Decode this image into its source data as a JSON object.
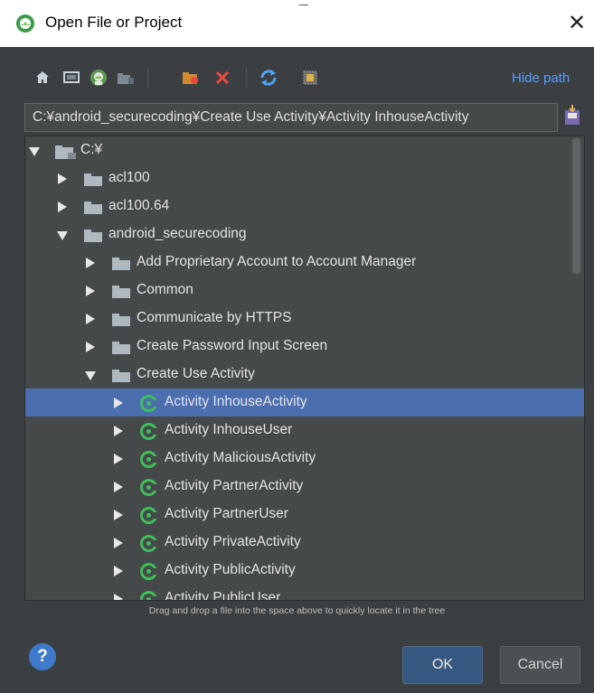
{
  "dialog": {
    "title": "Open File or Project",
    "close_symbol": "✕",
    "hide_path_label": "Hide path",
    "path_value": "C:¥android_securecoding¥Create Use Activity¥Activity InhouseActivity",
    "hint_text": "Drag and drop a file into the space above to quickly locate it in the tree",
    "help_label": "?",
    "ok_label": "OK",
    "cancel_label": "Cancel"
  },
  "toolbar": {
    "icons": [
      "home-icon",
      "desktop-icon",
      "android-project-icon",
      "module-folder-icon",
      "new-folder-icon",
      "delete-icon",
      "refresh-icon",
      "show-hidden-icon"
    ]
  },
  "tree": {
    "items": [
      {
        "label": "C:¥",
        "level": 0,
        "expanded": true,
        "icon": "drive-icon"
      },
      {
        "label": "acl100",
        "level": 1,
        "expanded": false,
        "icon": "folder-icon"
      },
      {
        "label": "acl100.64",
        "level": 1,
        "expanded": false,
        "icon": "folder-icon"
      },
      {
        "label": "android_securecoding",
        "level": 1,
        "expanded": true,
        "icon": "folder-icon"
      },
      {
        "label": "Add Proprietary Account to Account Manager",
        "level": 2,
        "expanded": false,
        "icon": "folder-icon"
      },
      {
        "label": "Common",
        "level": 2,
        "expanded": false,
        "icon": "folder-icon"
      },
      {
        "label": "Communicate by HTTPS",
        "level": 2,
        "expanded": false,
        "icon": "folder-icon"
      },
      {
        "label": "Create Password Input Screen",
        "level": 2,
        "expanded": false,
        "icon": "folder-icon"
      },
      {
        "label": "Create Use Activity",
        "level": 2,
        "expanded": true,
        "icon": "folder-icon"
      },
      {
        "label": "Activity InhouseActivity",
        "level": 3,
        "expanded": false,
        "icon": "module-icon",
        "selected": true
      },
      {
        "label": "Activity InhouseUser",
        "level": 3,
        "expanded": false,
        "icon": "module-icon"
      },
      {
        "label": "Activity MaliciousActivity",
        "level": 3,
        "expanded": false,
        "icon": "module-icon"
      },
      {
        "label": "Activity PartnerActivity",
        "level": 3,
        "expanded": false,
        "icon": "module-icon"
      },
      {
        "label": "Activity PartnerUser",
        "level": 3,
        "expanded": false,
        "icon": "module-icon"
      },
      {
        "label": "Activity PrivateActivity",
        "level": 3,
        "expanded": false,
        "icon": "module-icon"
      },
      {
        "label": "Activity PublicActivity",
        "level": 3,
        "expanded": false,
        "icon": "module-icon"
      },
      {
        "label": "Activity PublicUser",
        "level": 3,
        "expanded": false,
        "icon": "module-icon"
      }
    ]
  },
  "colors": {
    "selection": "#4b6eaf",
    "link": "#589df6",
    "module_green": "#3fbf5a",
    "delete_red": "#e84c3d",
    "new_folder_orange": "#e8a33d",
    "refresh_blue": "#4ea3f2"
  }
}
